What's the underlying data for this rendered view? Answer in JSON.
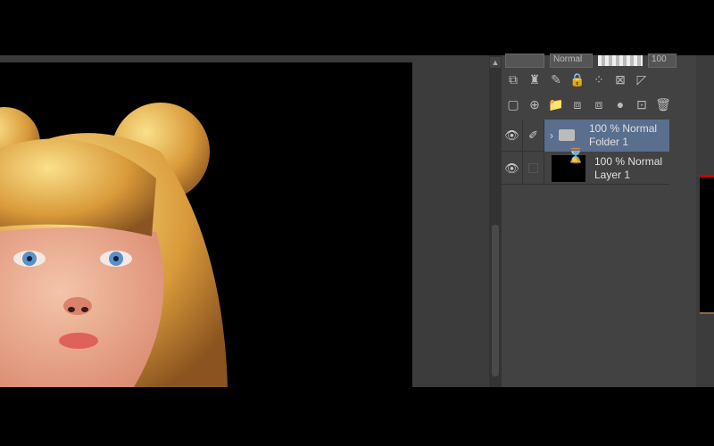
{
  "toolbar": {
    "blend_mode": "Normal",
    "opacity": "100"
  },
  "layers": [
    {
      "name": "Folder 1",
      "opacity": "100 %",
      "mode": "Normal",
      "type": "folder",
      "selected": true
    },
    {
      "name": "Layer 1",
      "opacity": "100 %",
      "mode": "Normal",
      "type": "raster",
      "selected": false
    }
  ],
  "colors": {
    "selected_layer": "#5a6e8e",
    "panel": "#424242",
    "accent_red": "#cc0000"
  }
}
